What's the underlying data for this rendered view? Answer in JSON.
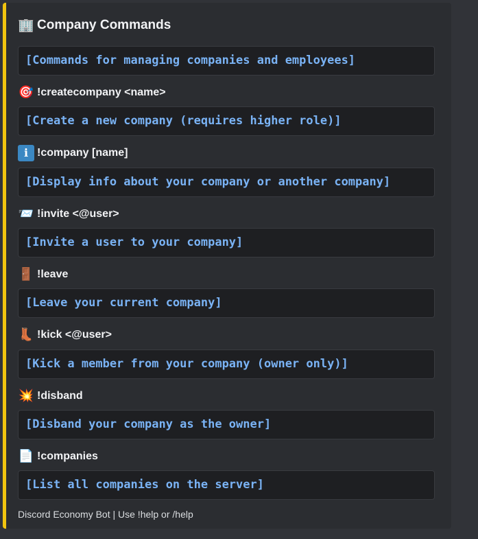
{
  "embed": {
    "accent_color": "#f1c40f",
    "title_icon": "office-building-icon",
    "title": "Company Commands",
    "description": "[Commands for managing companies and employees]",
    "commands": [
      {
        "icon": "target-icon",
        "glyph": "🎯",
        "name": "!createcompany <name>",
        "desc": "[Create a new company (requires higher role)]"
      },
      {
        "icon": "info-icon",
        "glyph": "ℹ",
        "name": "!company [name]",
        "desc": "[Display info about your company or another company]"
      },
      {
        "icon": "envelope-icon",
        "glyph": "📨",
        "name": "!invite <@user>",
        "desc": "[Invite a user to your company]"
      },
      {
        "icon": "door-icon",
        "glyph": "🚪",
        "name": "!leave",
        "desc": "[Leave your current company]"
      },
      {
        "icon": "boot-icon",
        "glyph": "👢",
        "name": "!kick <@user>",
        "desc": "[Kick a member from your company (owner only)]"
      },
      {
        "icon": "collision-icon",
        "glyph": "💥",
        "name": "!disband",
        "desc": "[Disband your company as the owner]"
      },
      {
        "icon": "page-icon",
        "glyph": "📄",
        "name": "!companies",
        "desc": "[List all companies on the server]"
      }
    ],
    "footer": "Discord Economy Bot | Use !help or /help"
  }
}
